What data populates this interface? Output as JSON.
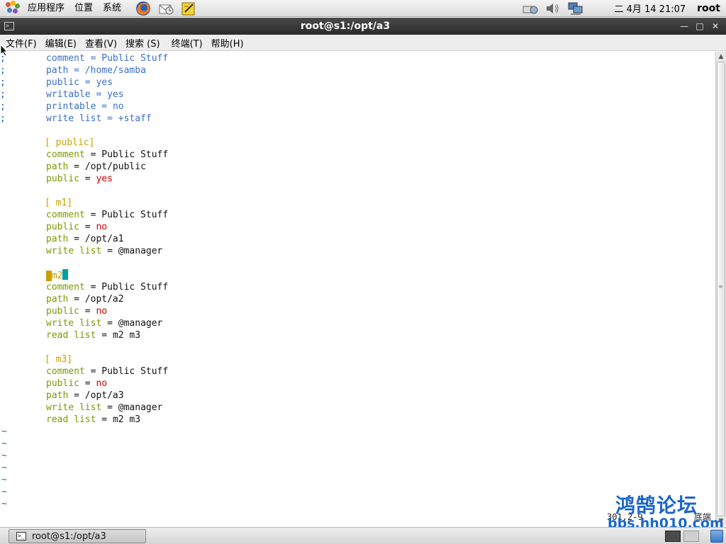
{
  "top_panel": {
    "menus": [
      "应用程序",
      "位置",
      "系统"
    ],
    "clock": "二 4月 14 21:07",
    "user": "root"
  },
  "window": {
    "title": "root@s1:/opt/a3",
    "menubar": [
      "文件(F)",
      "编辑(E)",
      "查看(V)",
      "搜索 (S)",
      "终端(T)",
      "帮助(H)"
    ]
  },
  "editor": {
    "commented_lines": [
      {
        "key": "comment",
        "op": " = ",
        "val": "Public Stuff"
      },
      {
        "key": "path",
        "op": " = ",
        "val": "/home/samba"
      },
      {
        "key": "public",
        "op": " = ",
        "val": "yes"
      },
      {
        "key": "writable",
        "op": " = ",
        "val": "yes"
      },
      {
        "key": "printable",
        "op": " = ",
        "val": "no"
      },
      {
        "key": "write list",
        "op": " = ",
        "val": "+staff"
      }
    ],
    "comment_char": ";",
    "sections": [
      {
        "header": "[ public]",
        "entries": [
          {
            "key": "comment",
            "val": "Public Stuff",
            "kind": "text"
          },
          {
            "key": "path",
            "val": "/opt/public",
            "kind": "text"
          },
          {
            "key": "public",
            "val": "yes",
            "kind": "bool"
          }
        ]
      },
      {
        "header": "[ m1]",
        "entries": [
          {
            "key": "comment",
            "val": "Public Stuff",
            "kind": "text"
          },
          {
            "key": "public",
            "val": "no",
            "kind": "bool"
          },
          {
            "key": "path",
            "val": "/opt/a1",
            "kind": "text"
          },
          {
            "key": "write list",
            "val": "@manager",
            "kind": "text"
          }
        ]
      },
      {
        "header": "m2",
        "entries": [
          {
            "key": "comment",
            "val": "Public Stuff",
            "kind": "text"
          },
          {
            "key": "path",
            "val": "/opt/a2",
            "kind": "text"
          },
          {
            "key": "public",
            "val": "no",
            "kind": "bool"
          },
          {
            "key": "write list",
            "val": "@manager",
            "kind": "text"
          },
          {
            "key": "read list",
            "val": "m2 m3",
            "kind": "text"
          }
        ]
      },
      {
        "header": "[ m3]",
        "entries": [
          {
            "key": "comment",
            "val": "Public Stuff",
            "kind": "text"
          },
          {
            "key": "public",
            "val": "no",
            "kind": "bool"
          },
          {
            "key": "path",
            "val": "/opt/a3",
            "kind": "text"
          },
          {
            "key": "write list",
            "val": "@manager",
            "kind": "text"
          },
          {
            "key": "read list",
            "val": "m2 m3",
            "kind": "text"
          }
        ]
      }
    ],
    "tilde_count": 7,
    "tilde_char": "~",
    "status": "301,2-9          底端"
  },
  "watermark": {
    "title": "鸿鹄论坛",
    "url": "bbs.hh010.com"
  },
  "taskbar": {
    "task_label": "root@s1:/opt/a3"
  },
  "colors": {
    "comment_blue": "#3a6fc7",
    "key_green": "#7a9a00",
    "header_yellow": "#c8a000",
    "bool_red": "#d00000",
    "watermark_blue": "#1b66c9"
  }
}
